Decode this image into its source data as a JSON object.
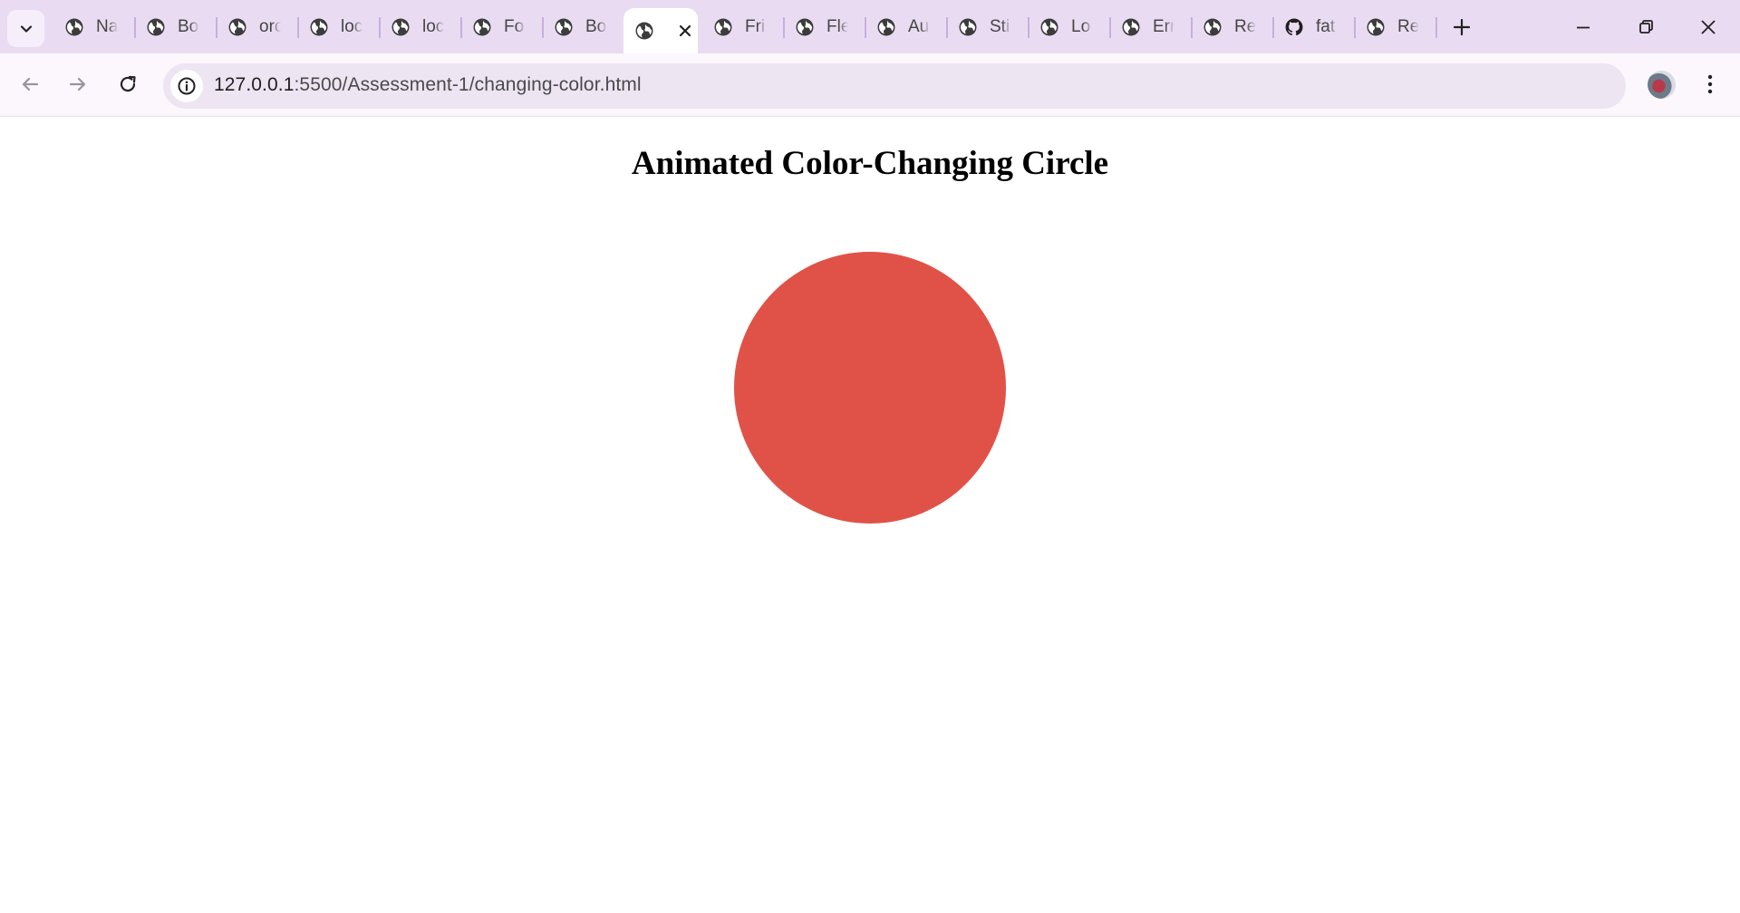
{
  "browser": {
    "tabs": [
      {
        "title": "Na",
        "icon": "globe-icon",
        "active": false
      },
      {
        "title": "Bo",
        "icon": "globe-icon",
        "active": false
      },
      {
        "title": "orc",
        "icon": "globe-icon",
        "active": false
      },
      {
        "title": "loc",
        "icon": "globe-icon",
        "active": false
      },
      {
        "title": "loc",
        "icon": "globe-icon",
        "active": false
      },
      {
        "title": "Fo",
        "icon": "globe-icon",
        "active": false
      },
      {
        "title": "Bo",
        "icon": "globe-icon",
        "active": false
      },
      {
        "title": "",
        "icon": "globe-icon",
        "active": true
      },
      {
        "title": "Fri",
        "icon": "globe-icon",
        "active": false
      },
      {
        "title": "Fle",
        "icon": "globe-icon",
        "active": false
      },
      {
        "title": "Au",
        "icon": "globe-icon",
        "active": false
      },
      {
        "title": "Sti",
        "icon": "globe-icon",
        "active": false
      },
      {
        "title": "Lo",
        "icon": "globe-icon",
        "active": false
      },
      {
        "title": "Err",
        "icon": "globe-icon",
        "active": false
      },
      {
        "title": "Re",
        "icon": "globe-icon",
        "active": false
      },
      {
        "title": "fat",
        "icon": "github-icon",
        "active": false
      },
      {
        "title": "Re",
        "icon": "globe-icon",
        "active": false
      }
    ],
    "address_bar": {
      "host": "127.0.0.1",
      "path": ":5500/Assessment-1/changing-color.html"
    },
    "colors": {
      "tabstrip": "#e9dcf2",
      "toolbar": "#fbf7fd",
      "omnibox": "#ede5f2"
    }
  },
  "page": {
    "title": "Animated Color-Changing Circle",
    "circle_color": "#e05247"
  }
}
